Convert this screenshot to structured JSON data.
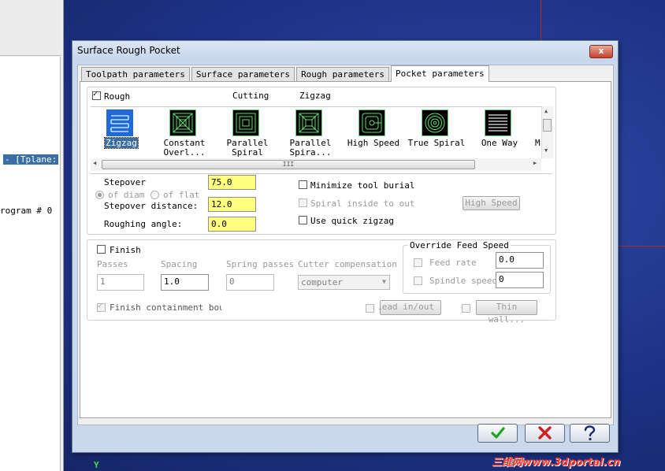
{
  "background": {
    "left_panel_text_1": "- [Tplane: ",
    "left_panel_text_2": "rogram # 0",
    "axis_label": "Y",
    "watermark": "三维网www.3dportal.cn"
  },
  "dialog": {
    "title": "Surface Rough Pocket",
    "close_label": "x",
    "tabs": [
      {
        "label": "Toolpath parameters",
        "active": false
      },
      {
        "label": "Surface parameters",
        "active": false
      },
      {
        "label": "Rough parameters",
        "active": false
      },
      {
        "label": "Pocket parameters",
        "active": true
      }
    ],
    "rough": {
      "checkbox_label": "Rough",
      "checked": true,
      "cutting_label": "Cutting",
      "cutting_value": "Zigzag",
      "tools": [
        {
          "label1": "Zigzag",
          "label2": "",
          "icon": "zigzag-icon",
          "selected": true
        },
        {
          "label1": "Constant",
          "label2": "Overl...",
          "icon": "constant-overlap-icon",
          "selected": false
        },
        {
          "label1": "Parallel",
          "label2": "Spiral",
          "icon": "parallel-spiral-icon",
          "selected": false
        },
        {
          "label1": "Parallel",
          "label2": "Spira...",
          "icon": "parallel-spiral-clean-icon",
          "selected": false
        },
        {
          "label1": "High Speed",
          "label2": "",
          "icon": "high-speed-icon",
          "selected": false
        },
        {
          "label1": "True Spiral",
          "label2": "",
          "icon": "true-spiral-icon",
          "selected": false
        },
        {
          "label1": "One Way",
          "label2": "",
          "icon": "one-way-icon",
          "selected": false
        },
        {
          "label1": "M",
          "label2": "",
          "icon": "morph-spiral-icon",
          "selected": false
        }
      ],
      "scroll_thumb_glyph": "III",
      "stepover_label": "Stepover",
      "stepover_value": "75.0",
      "of_diam_label": "of diam",
      "of_flat_label": "of flat",
      "stepover_distance_label": "Stepover distance:",
      "stepover_distance_value": "12.0",
      "roughing_angle_label": "Roughing angle:",
      "roughing_angle_value": "0.0",
      "minimize_label": "Minimize tool burial",
      "spiral_inside_label": "Spiral inside to outsi",
      "quick_zigzag_label": "Use quick zigzag",
      "high_speed_button": "High Speed"
    },
    "finish": {
      "checkbox_label": "Finish",
      "passes_label": "Passes",
      "passes_value": "1",
      "spacing_label": "Spacing",
      "spacing_value": "1.0",
      "spring_label": "Spring passes",
      "spring_value": "0",
      "cutter_comp_label": "Cutter compensation",
      "cutter_comp_value": "computer",
      "containment_label": "Finish containment bound",
      "lead_button": "Lead in/out...",
      "thin_wall_button": "Thin wall..."
    },
    "override": {
      "legend": "Override Feed Speed",
      "feed_rate_label": "Feed rate",
      "feed_rate_value": "0.0",
      "spindle_label": "Spindle speed",
      "spindle_value": "0"
    },
    "buttons": {
      "ok_icon": "check-icon",
      "cancel_icon": "x-icon",
      "help_icon": "question-icon",
      "ok_color": "#1fa51f",
      "cancel_color": "#d02020",
      "help_color": "#1a2a6a"
    }
  }
}
